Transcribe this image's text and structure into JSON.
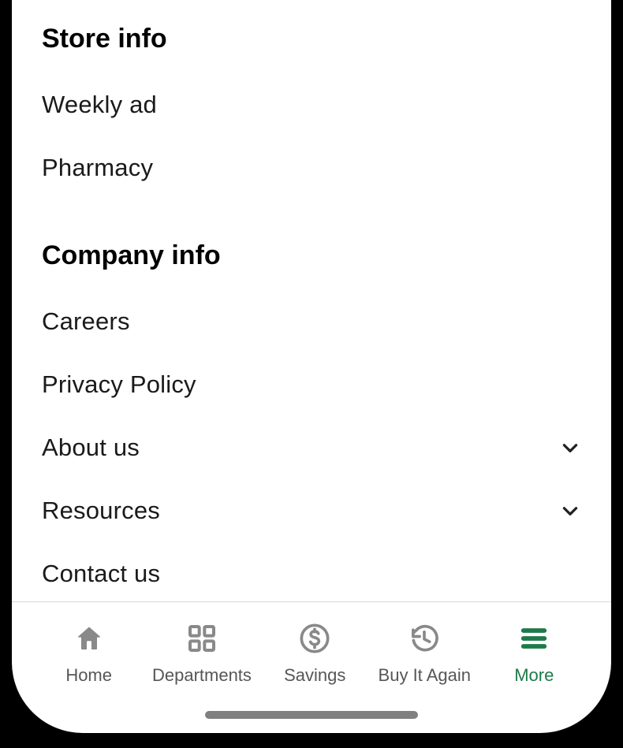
{
  "colors": {
    "accent": "#1e7a4a",
    "text": "#1a1a1a",
    "muted": "#565656",
    "divider": "#d9d9d9"
  },
  "store_info": {
    "heading": "Store info",
    "items": [
      {
        "label": "Weekly ad",
        "expandable": false
      },
      {
        "label": "Pharmacy",
        "expandable": false
      }
    ]
  },
  "company_info": {
    "heading": "Company info",
    "items": [
      {
        "label": "Careers",
        "expandable": false
      },
      {
        "label": "Privacy Policy",
        "expandable": false
      },
      {
        "label": "About us",
        "expandable": true
      },
      {
        "label": "Resources",
        "expandable": true
      },
      {
        "label": "Contact us",
        "expandable": false
      }
    ]
  },
  "tabs": [
    {
      "label": "Home",
      "icon": "home",
      "active": false
    },
    {
      "label": "Departments",
      "icon": "grid",
      "active": false
    },
    {
      "label": "Savings",
      "icon": "dollar",
      "active": false
    },
    {
      "label": "Buy It Again",
      "icon": "history",
      "active": false
    },
    {
      "label": "More",
      "icon": "menu",
      "active": true
    }
  ]
}
